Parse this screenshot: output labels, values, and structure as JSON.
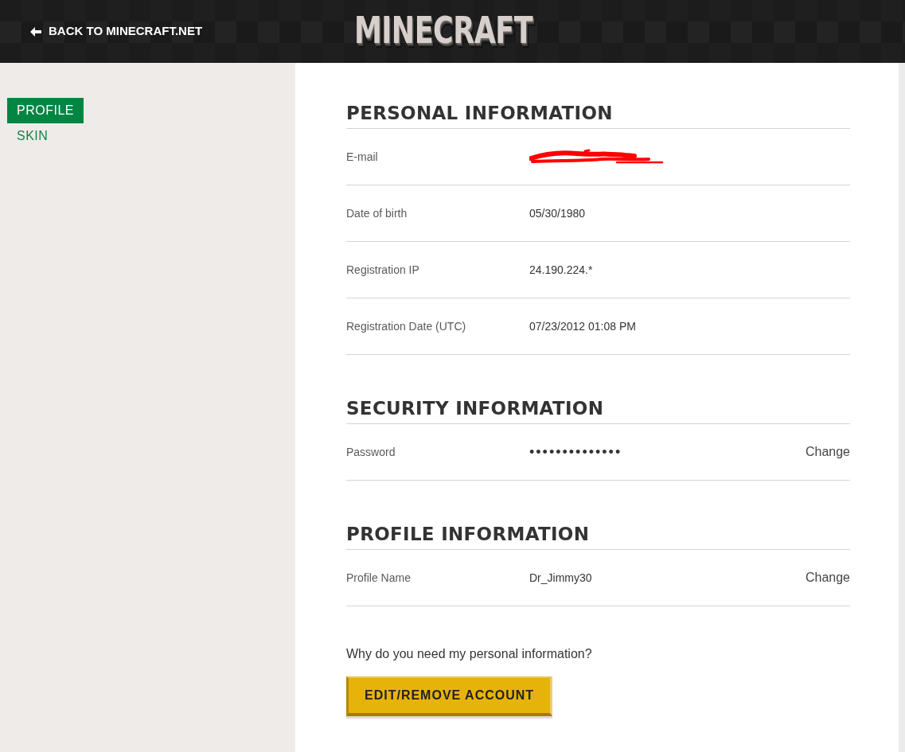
{
  "header": {
    "back_link": "BACK TO MINECRAFT.NET",
    "logo": "MINECRAFT"
  },
  "sidebar": {
    "items": [
      {
        "label": "PROFILE",
        "selected": true
      },
      {
        "label": "SKIN",
        "selected": false
      }
    ]
  },
  "sections": [
    {
      "title": "PERSONAL INFORMATION",
      "rows": [
        {
          "label": "E-mail",
          "kind": "redacted"
        },
        {
          "label": "Date of birth",
          "kind": "text",
          "value": "05/30/1980"
        },
        {
          "label": "Registration IP",
          "kind": "text",
          "value": "24.190.224.*"
        },
        {
          "label": "Registration Date (UTC)",
          "kind": "text",
          "value": "07/23/2012 01:08 PM"
        }
      ]
    },
    {
      "title": "SECURITY INFORMATION",
      "rows": [
        {
          "label": "Password",
          "kind": "masked",
          "value": "••••••••••••••",
          "action": "Change"
        }
      ]
    },
    {
      "title": "PROFILE INFORMATION",
      "rows": [
        {
          "label": "Profile Name",
          "kind": "text",
          "value": "Dr_Jimmy30",
          "action": "Change"
        }
      ]
    }
  ],
  "footer": {
    "question": "Why do you need my personal information?",
    "button": "EDIT/REMOVE ACCOUNT"
  }
}
